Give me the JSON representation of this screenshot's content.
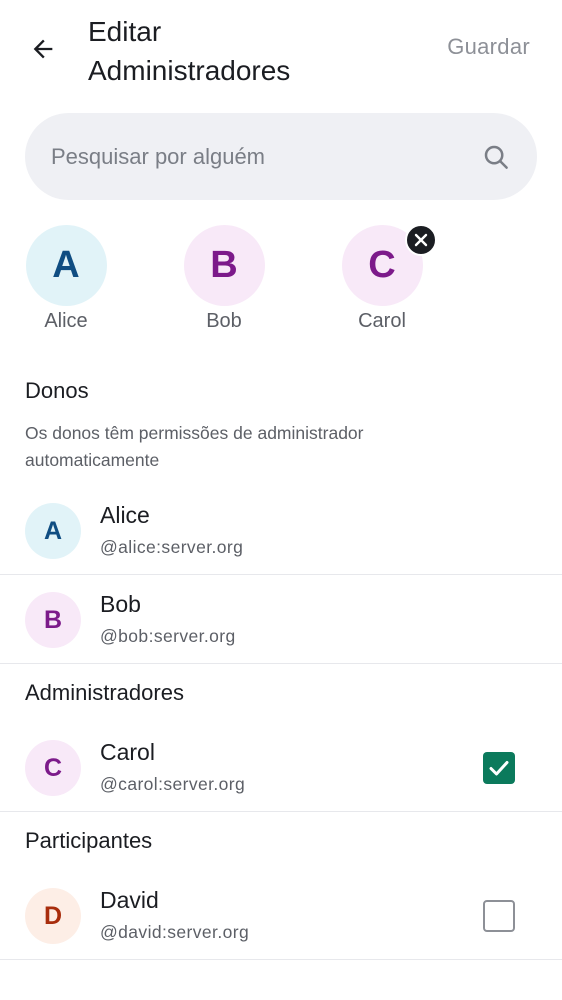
{
  "header": {
    "title_line1": "Editar",
    "title_line2": "Administradores",
    "save_label": "Guardar",
    "back_icon": "arrow-left-icon"
  },
  "search": {
    "placeholder": "Pesquisar por alguém",
    "value": "",
    "icon": "search-icon"
  },
  "selected_users": [
    {
      "initial": "A",
      "name": "Alice",
      "removable": false
    },
    {
      "initial": "B",
      "name": "Bob",
      "removable": false
    },
    {
      "initial": "C",
      "name": "Carol",
      "removable": true
    }
  ],
  "sections": {
    "owners": {
      "title": "Donos",
      "description": "Os donos têm permissões de administrador automaticamente",
      "members": [
        {
          "initial": "A",
          "name": "Alice",
          "id": "@alice:server.org"
        },
        {
          "initial": "B",
          "name": "Bob",
          "id": "@bob:server.org"
        }
      ]
    },
    "admins": {
      "title": "Administradores",
      "members": [
        {
          "initial": "C",
          "name": "Carol",
          "id": "@carol:server.org",
          "checked": true
        }
      ]
    },
    "participants": {
      "title": "Participantes",
      "members": [
        {
          "initial": "D",
          "name": "David",
          "id": "@david:server.org",
          "checked": false
        }
      ]
    }
  },
  "colors": {
    "accent_checkbox": "#0b7a5c",
    "avatar_blue_bg": "#e1f3f8",
    "avatar_purple_bg": "#f8e9f8",
    "avatar_orange_bg": "#fdeee6"
  }
}
